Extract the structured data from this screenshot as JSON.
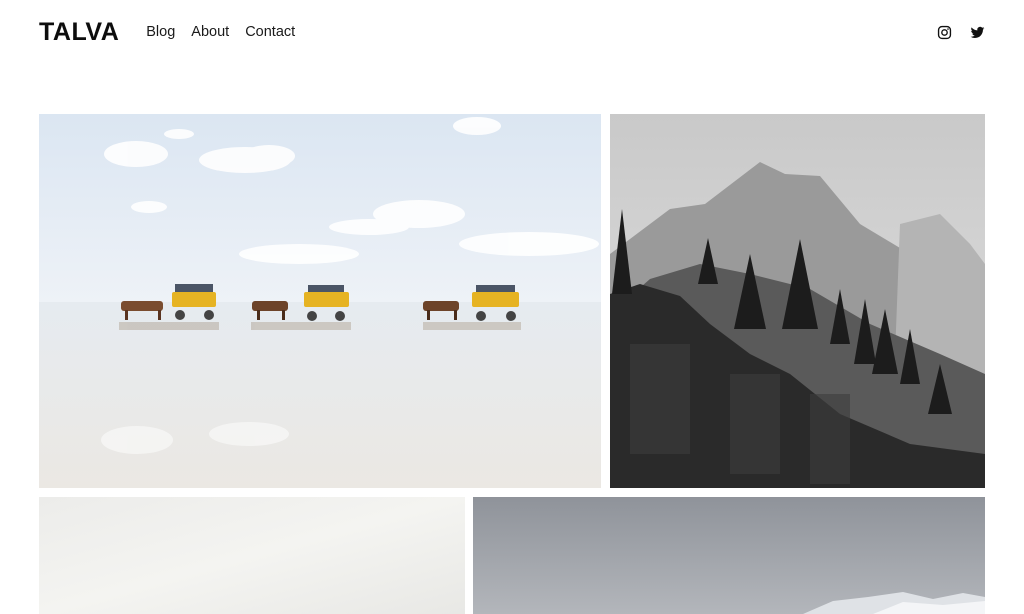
{
  "site": {
    "logo": "TALVA"
  },
  "nav": {
    "items": [
      "Blog",
      "About",
      "Contact"
    ]
  },
  "social": {
    "icons": [
      "instagram-icon",
      "twitter-icon"
    ]
  },
  "gallery": {
    "photos": [
      {
        "subject": "horse-carriages-on-tidal-flat"
      },
      {
        "subject": "mountain-cliff-black-and-white"
      },
      {
        "subject": "hazy-white-sky"
      },
      {
        "subject": "grey-cloudy-sky-with-snow-peaks"
      }
    ]
  },
  "colors": {
    "text": "#111111",
    "background": "#ffffff",
    "carriage_yellow": "#e6b323"
  }
}
